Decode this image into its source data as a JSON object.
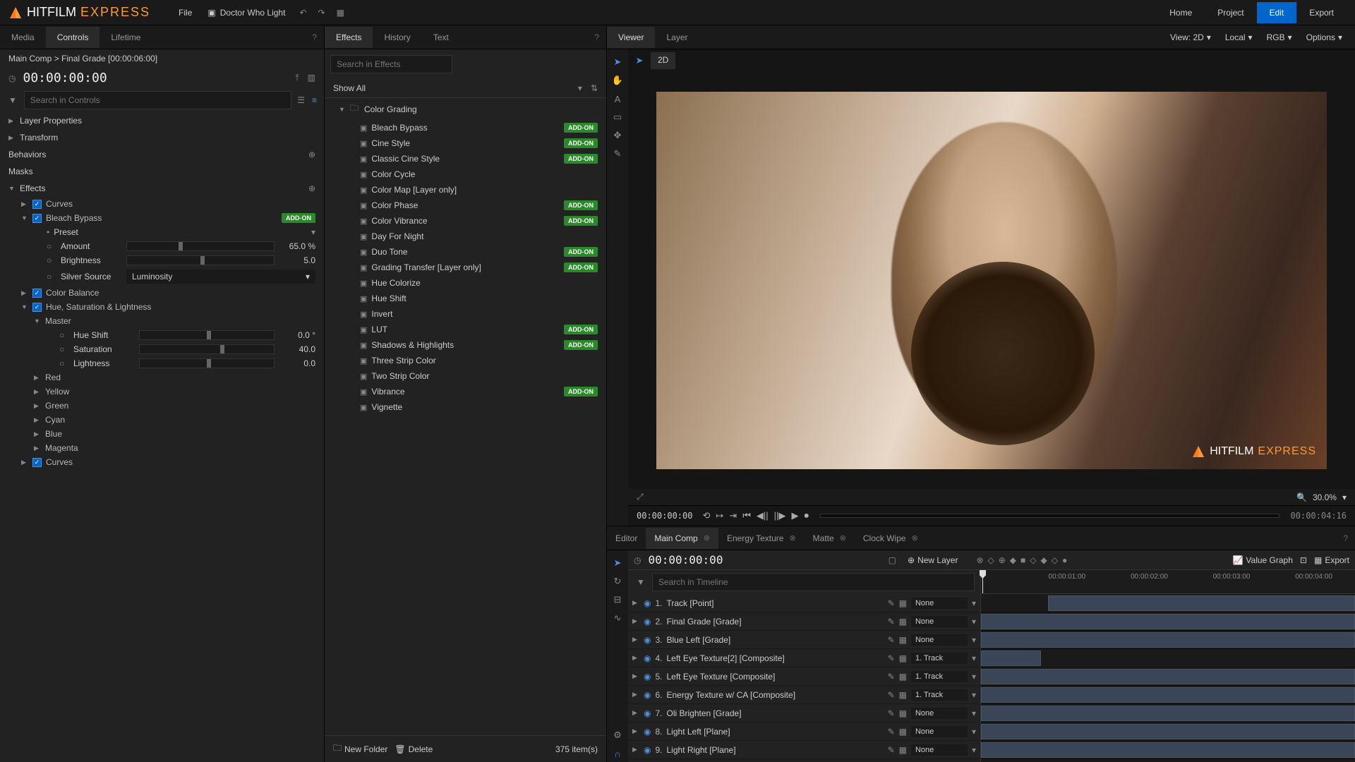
{
  "titlebar": {
    "brand": "HITFILM",
    "brand_sub": "EXPRESS",
    "file_menu": "File",
    "project_name": "Doctor Who Light",
    "tabs": [
      "Home",
      "Project",
      "Edit",
      "Export"
    ],
    "active_tab": 2
  },
  "controls_panel": {
    "tabs": [
      "Media",
      "Controls",
      "Lifetime"
    ],
    "active": 1,
    "breadcrumb": "Main Comp > Final Grade [00:00:06:00]",
    "timecode": "00:00:00:00",
    "search_ph": "Search in Controls",
    "groups": {
      "layer_props": "Layer Properties",
      "transform": "Transform",
      "behaviors": "Behaviors",
      "masks": "Masks",
      "effects": "Effects"
    },
    "effects": [
      {
        "name": "Curves",
        "checked": true
      },
      {
        "name": "Bleach Bypass",
        "checked": true,
        "addon": true,
        "expanded": true,
        "preset_label": "Preset",
        "params": [
          {
            "name": "Amount",
            "value": "65.0 %",
            "pos": 35
          },
          {
            "name": "Brightness",
            "value": "5.0",
            "pos": 50
          },
          {
            "name": "Silver Source",
            "dropdown": "Luminosity"
          }
        ]
      },
      {
        "name": "Color Balance",
        "checked": true
      },
      {
        "name": "Hue, Saturation & Lightness",
        "checked": true,
        "expanded": true,
        "master_label": "Master",
        "params": [
          {
            "name": "Hue Shift",
            "value": "0.0 °",
            "pos": 50
          },
          {
            "name": "Saturation",
            "value": "40.0",
            "pos": 60
          },
          {
            "name": "Lightness",
            "value": "0.0",
            "pos": 50
          }
        ],
        "channels": [
          "Red",
          "Yellow",
          "Green",
          "Cyan",
          "Blue",
          "Magenta"
        ]
      },
      {
        "name": "Curves",
        "checked": true
      }
    ]
  },
  "effects_panel": {
    "tabs": [
      "Effects",
      "History",
      "Text"
    ],
    "active": 0,
    "search_ph": "Search in Effects",
    "show_all": "Show All",
    "category": "Color Grading",
    "items": [
      {
        "name": "Bleach Bypass",
        "addon": true
      },
      {
        "name": "Cine Style",
        "addon": true
      },
      {
        "name": "Classic Cine Style",
        "addon": true
      },
      {
        "name": "Color Cycle"
      },
      {
        "name": "Color Map [Layer only]"
      },
      {
        "name": "Color Phase",
        "addon": true
      },
      {
        "name": "Color Vibrance",
        "addon": true
      },
      {
        "name": "Day For Night"
      },
      {
        "name": "Duo Tone",
        "addon": true
      },
      {
        "name": "Grading Transfer [Layer only]",
        "addon": true
      },
      {
        "name": "Hue Colorize"
      },
      {
        "name": "Hue Shift"
      },
      {
        "name": "Invert"
      },
      {
        "name": "LUT",
        "addon": true
      },
      {
        "name": "Shadows & Highlights",
        "addon": true
      },
      {
        "name": "Three Strip Color"
      },
      {
        "name": "Two Strip Color"
      },
      {
        "name": "Vibrance",
        "addon": true
      },
      {
        "name": "Vignette"
      }
    ],
    "footer": {
      "new_folder": "New Folder",
      "delete": "Delete",
      "count": "375 item(s)"
    },
    "addon_label": "ADD-ON"
  },
  "viewer": {
    "tabs": [
      "Viewer",
      "Layer"
    ],
    "active": 0,
    "view_mode": "View: 2D",
    "space": "Local",
    "channels": "RGB",
    "options": "Options",
    "btn_2d": "2D",
    "zoom": "30.0%",
    "tc_current": "00:00:00:00",
    "tc_end": "00:00:04:16",
    "watermark_brand": "HITFILM",
    "watermark_sub": "EXPRESS"
  },
  "timeline": {
    "tabs": [
      {
        "name": "Editor"
      },
      {
        "name": "Main Comp",
        "closable": true,
        "active": true
      },
      {
        "name": "Energy Texture",
        "closable": true
      },
      {
        "name": "Matte",
        "closable": true
      },
      {
        "name": "Clock Wipe",
        "closable": true
      }
    ],
    "timecode": "00:00:00:00",
    "new_layer": "New Layer",
    "value_graph": "Value Graph",
    "export": "Export",
    "search_ph": "Search in Timeline",
    "ruler": [
      "00:00:01:00",
      "00:00:02:00",
      "00:00:03:00",
      "00:00:04:00"
    ],
    "tracks": [
      {
        "num": "1.",
        "name": "Track [Point]",
        "mode": "None",
        "clip": [
          18,
          100
        ]
      },
      {
        "num": "2.",
        "name": "Final Grade [Grade]",
        "mode": "None",
        "clip": [
          0,
          100
        ]
      },
      {
        "num": "3.",
        "name": "Blue Left [Grade]",
        "mode": "None",
        "clip": [
          0,
          100
        ]
      },
      {
        "num": "4.",
        "name": "Left Eye Texture[2] [Composite]",
        "mode": "1. Track",
        "clip": [
          0,
          16
        ]
      },
      {
        "num": "5.",
        "name": "Left Eye Texture [Composite]",
        "mode": "1. Track",
        "clip": [
          0,
          100
        ]
      },
      {
        "num": "6.",
        "name": "Energy Texture w/ CA [Composite]",
        "mode": "1. Track",
        "clip": [
          0,
          100
        ]
      },
      {
        "num": "7.",
        "name": "Oli Brighten [Grade]",
        "mode": "None",
        "clip": [
          0,
          100
        ]
      },
      {
        "num": "8.",
        "name": "Light Left [Plane]",
        "mode": "None",
        "clip": [
          0,
          100
        ]
      },
      {
        "num": "9.",
        "name": "Light Right [Plane]",
        "mode": "None",
        "clip": [
          0,
          100
        ]
      }
    ]
  }
}
